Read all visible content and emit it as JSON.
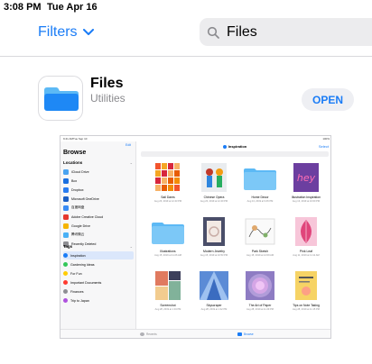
{
  "status_bar": {
    "time": "3:08 PM",
    "date": "Tue Apr 16"
  },
  "header": {
    "filters_label": "Filters",
    "search_value": "Files"
  },
  "app": {
    "name": "Files",
    "category": "Utilities",
    "open_label": "OPEN"
  },
  "colors": {
    "accent": "#1a7cf6",
    "folder": "#1e88f5",
    "folder_light": "#5cb9f5"
  },
  "icons": {
    "filters_chevron": "chevron-down-icon",
    "search": "search-icon",
    "app": "folder-icon"
  },
  "preview": {
    "status_time": "9:41 AM",
    "status_date": "Tue Sep 10",
    "status_battery": "100%",
    "edit_label": "Edit",
    "browse_title": "Browse",
    "locations_header": "Locations",
    "locations": [
      {
        "label": "iCloud Drive",
        "color": "#4aa3f0"
      },
      {
        "label": "Box",
        "color": "#1a6fe0"
      },
      {
        "label": "Dropbox",
        "color": "#2a7cf0"
      },
      {
        "label": "Microsoft OneDrive",
        "color": "#1c5fc4"
      },
      {
        "label": "百度网盘",
        "color": "#3a8cf4"
      },
      {
        "label": "Adobe Creative Cloud",
        "color": "#e6372c"
      },
      {
        "label": "Google Drive",
        "color": "#f5b400"
      },
      {
        "label": "腾讯微云",
        "color": "#4ab0f5"
      },
      {
        "label": "Recently Deleted",
        "color": "#8e8e93"
      }
    ],
    "tags_header": "Tags",
    "tags": [
      {
        "label": "Inspiration",
        "color": "#1a7cf6"
      },
      {
        "label": "Gardening Ideas",
        "color": "#34c759"
      },
      {
        "label": "For Fun",
        "color": "#ffcc00"
      },
      {
        "label": "Important Documents",
        "color": "#ff3b30"
      },
      {
        "label": "Finances",
        "color": "#8e8e93"
      },
      {
        "label": "Trip to Japan",
        "color": "#af52de"
      }
    ],
    "main_title": "Inspiration",
    "select_label": "Select",
    "files": [
      {
        "name": "Sail Dams",
        "date": "Aug 26, 2019 at 12:43 PM",
        "art": "grid-orange"
      },
      {
        "name": "Chinese Opera",
        "date": "Aug 20, 2019 at 12:40 PM",
        "art": "figures"
      },
      {
        "name": "Home Decor",
        "date": "Aug 13, 2019 at 9:45 PM",
        "art": "folder"
      },
      {
        "name": "Illustration Inspiration",
        "date": "Aug 13, 2019 at 10:00 PM",
        "art": "hey"
      },
      {
        "name": "Illustrations",
        "date": "Aug 15, 2019 at 11:26 AM",
        "art": "folder"
      },
      {
        "name": "Modern Jewelry",
        "date": "Aug 15, 2019 at 10:53 PM",
        "art": "jewelry"
      },
      {
        "name": "Park Sketch",
        "date": "Aug 15, 2019 at 12:09 AM",
        "art": "sketch"
      },
      {
        "name": "Pink Leaf",
        "date": "Aug 11, 2019 at 11:11 AM",
        "art": "leaf"
      },
      {
        "name": "Screenshot",
        "date": "Aug 28, 2019 at 1:34 PM",
        "art": "collage"
      },
      {
        "name": "Skyscraper",
        "date": "Aug 28, 2019 at 1:42 PM",
        "art": "skyscraper"
      },
      {
        "name": "The Art of Paper",
        "date": "Aug 28, 2019 at 11:29 PM",
        "art": "paper"
      },
      {
        "name": "Tips on Note Taking",
        "date": "Aug 28, 2019 at 11:15 PM",
        "art": "notes"
      }
    ],
    "tabbar": {
      "recents_label": "Recents",
      "browse_label": "Browse"
    }
  }
}
